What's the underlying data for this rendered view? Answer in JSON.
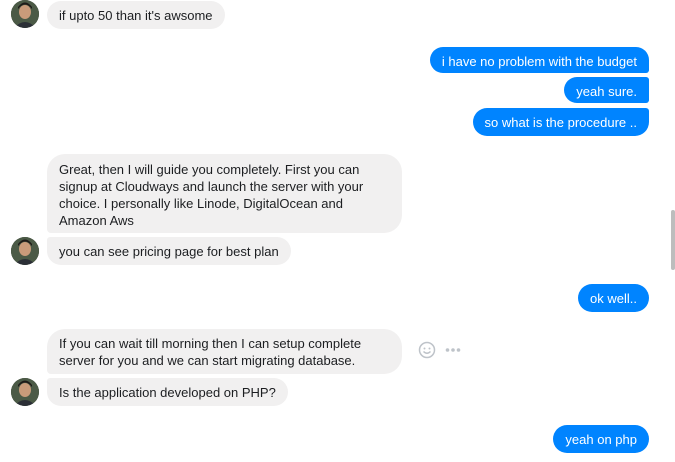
{
  "messages": [
    {
      "side": "in",
      "text": "if upto 50 than it's awsome"
    },
    {
      "side": "out",
      "text": "i have no problem with the budget"
    },
    {
      "side": "out",
      "text": "yeah sure."
    },
    {
      "side": "out",
      "text": "so what is the procedure .."
    },
    {
      "side": "in",
      "text": "Great, then I will guide you completely. First you can signup at Cloudways and launch the server with your choice. I personally like Linode, DigitalOcean and Amazon Aws"
    },
    {
      "side": "in",
      "text": "you can see pricing page for best plan"
    },
    {
      "side": "out",
      "text": "ok well.."
    },
    {
      "side": "in",
      "text": "If you can wait till morning then I can setup complete server for you and we can start migrating database."
    },
    {
      "side": "in",
      "text": "Is the application developed on PHP?"
    },
    {
      "side": "out",
      "text": "yeah on php"
    }
  ],
  "icons": {
    "avatar": "user-avatar",
    "react": "smiley-face-icon",
    "more": "more-options-icon"
  },
  "colors": {
    "outgoing_bubble": "#0084ff",
    "incoming_bubble": "#f1f0f0",
    "text_dark": "#1c1e21"
  }
}
